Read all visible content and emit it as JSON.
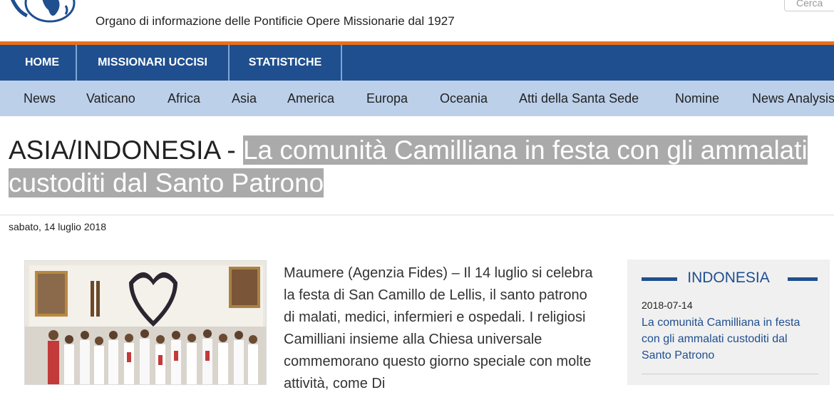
{
  "header": {
    "tagline": "Organo di informazione delle Pontificie Opere Missionarie dal 1927",
    "search_placeholder": "Cerca"
  },
  "nav_main": [
    "HOME",
    "MISSIONARI UCCISI",
    "STATISTICHE"
  ],
  "nav_sub": [
    "News",
    "Vaticano",
    "Africa",
    "Asia",
    "America",
    "Europa",
    "Oceania",
    "Atti della Santa Sede",
    "Nomine",
    "News Analysis"
  ],
  "article": {
    "region": "ASIA/INDONESIA - ",
    "title": "La comunità Camilliana in festa con gli ammalati custoditi dal Santo Patrono",
    "date": "sabato, 14 luglio 2018",
    "body": "Maumere (Agenzia Fides) – Il 14 luglio si celebra la festa di San Camillo de Lellis, il santo patrono di malati, medici, infermieri e ospedali. I religiosi Camilliani insieme alla Chiesa universale commemorano questo giorno speciale con molte attività, come Di"
  },
  "sidebar": {
    "title": "INDONESIA",
    "item_date": "2018-07-14",
    "item_title": "La comunità Camilliana in festa con gli ammalati custoditi dal Santo Patrono"
  },
  "colors": {
    "nav_blue": "#1f4f8f",
    "sub_nav": "#bcd0ea",
    "orange": "#e8711a",
    "title_highlight": "#aaaaaa"
  }
}
